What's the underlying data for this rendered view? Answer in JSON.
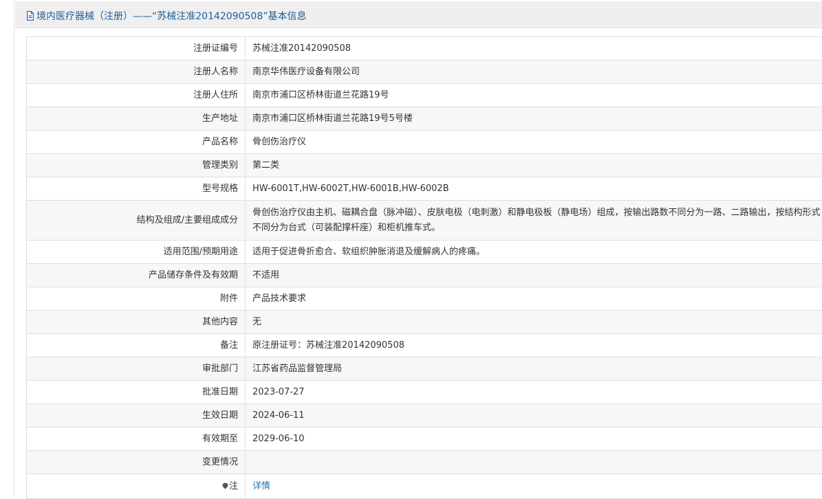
{
  "header": {
    "title": "境内医疗器械（注册）——“苏械注准20142090508”基本信息"
  },
  "rows": [
    {
      "label": "注册证编号",
      "value": "苏械注准20142090508"
    },
    {
      "label": "注册人名称",
      "value": "南京华伟医疗设备有限公司"
    },
    {
      "label": "注册人住所",
      "value": "南京市浦口区桥林街道兰花路19号"
    },
    {
      "label": "生产地址",
      "value": "南京市浦口区桥林街道兰花路19号5号楼"
    },
    {
      "label": "产品名称",
      "value": "骨创伤治疗仪"
    },
    {
      "label": "管理类别",
      "value": "第二类"
    },
    {
      "label": "型号规格",
      "value": "HW-6001T,HW-6002T,HW-6001B,HW-6002B"
    },
    {
      "label": "结构及组成/主要组成成分",
      "value": "骨创伤治疗仪由主机、磁耦合盘（脉冲磁）、皮肤电极（电刺激）和静电极板（静电场）组成，按输出路数不同分为一路、二路输出，按结构形式不同分为台式（可装配撑杆座）和柜机推车式。"
    },
    {
      "label": "适用范围/预期用途",
      "value": "适用于促进骨折愈合、软组织肿胀消退及缓解病人的疼痛。"
    },
    {
      "label": "产品储存条件及有效期",
      "value": "不适用"
    },
    {
      "label": "附件",
      "value": "产品技术要求"
    },
    {
      "label": "其他内容",
      "value": "无"
    },
    {
      "label": "备注",
      "value": "原注册证号：苏械注准20142090508"
    },
    {
      "label": "审批部门",
      "value": "江苏省药品监督管理局"
    },
    {
      "label": "批准日期",
      "value": "2023-07-27"
    },
    {
      "label": "生效日期",
      "value": "2024-06-11"
    },
    {
      "label": "有效期至",
      "value": "2029-06-10"
    },
    {
      "label": "变更情况",
      "value": ""
    }
  ],
  "note_row": {
    "label": "注",
    "link_text": "详情",
    "icon": "pin-icon"
  },
  "colors": {
    "header_text": "#1f5d9a",
    "link": "#2a6cb3",
    "border": "#dedede",
    "alt_row": "#f7f7f7"
  }
}
